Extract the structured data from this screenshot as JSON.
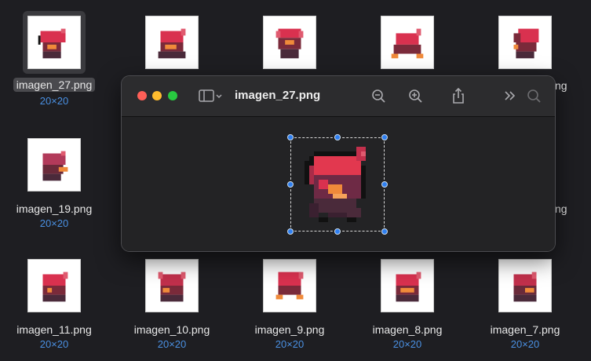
{
  "files": [
    {
      "name": "imagen_27.png",
      "size": "20×20"
    },
    {
      "name": "imagen_19.png",
      "size": "20×20"
    },
    {
      "name": "imagen_11.png",
      "size": "20×20"
    },
    {
      "name": "imagen_10.png",
      "size": "20×20"
    },
    {
      "name": "imagen_9.png",
      "size": "20×20"
    },
    {
      "name": "imagen_8.png",
      "size": "20×20"
    },
    {
      "name": "imagen_7.png",
      "size": "20×20"
    }
  ],
  "partial_labels": {
    "right_row1": "ng",
    "right_row2": "ng"
  },
  "preview": {
    "title": "imagen_27.png",
    "icons": [
      "sidebar-toggle-icon",
      "chevron-down-icon",
      "zoom-out-icon",
      "zoom-in-icon",
      "share-icon",
      "more-icon",
      "search-icon"
    ]
  },
  "colors": {
    "accent": "#2f7ff0",
    "size_text": "#4a90e2",
    "close": "#fe5f57",
    "minimize": "#febc2e",
    "zoom": "#28c840"
  }
}
